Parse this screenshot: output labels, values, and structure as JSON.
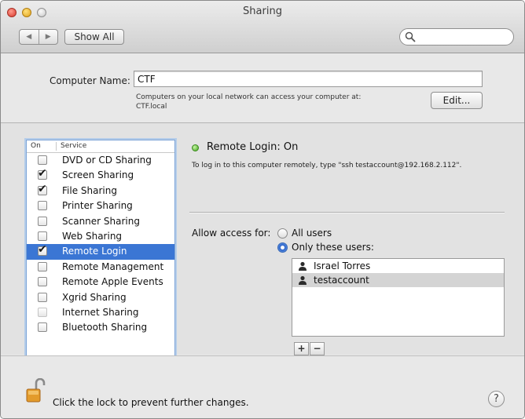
{
  "window": {
    "title": "Sharing"
  },
  "toolbar": {
    "back_glyph": "◀",
    "forward_glyph": "▶",
    "show_all_label": "Show All",
    "search": {
      "value": "",
      "placeholder": ""
    }
  },
  "computer_name": {
    "label": "Computer Name:",
    "value": "CTF",
    "description_line1": "Computers on your local network can access your computer at:",
    "description_line2": "CTF.local",
    "edit_label": "Edit..."
  },
  "services": {
    "header_on": "On",
    "header_service": "Service",
    "items": [
      {
        "label": "DVD or CD Sharing",
        "checked": false,
        "selected": false,
        "dimmed": false
      },
      {
        "label": "Screen Sharing",
        "checked": true,
        "selected": false,
        "dimmed": false
      },
      {
        "label": "File Sharing",
        "checked": true,
        "selected": false,
        "dimmed": false
      },
      {
        "label": "Printer Sharing",
        "checked": false,
        "selected": false,
        "dimmed": false
      },
      {
        "label": "Scanner Sharing",
        "checked": false,
        "selected": false,
        "dimmed": false
      },
      {
        "label": "Web Sharing",
        "checked": false,
        "selected": false,
        "dimmed": false
      },
      {
        "label": "Remote Login",
        "checked": true,
        "selected": true,
        "dimmed": false
      },
      {
        "label": "Remote Management",
        "checked": false,
        "selected": false,
        "dimmed": false
      },
      {
        "label": "Remote Apple Events",
        "checked": false,
        "selected": false,
        "dimmed": false
      },
      {
        "label": "Xgrid Sharing",
        "checked": false,
        "selected": false,
        "dimmed": false
      },
      {
        "label": "Internet Sharing",
        "checked": false,
        "selected": false,
        "dimmed": true
      },
      {
        "label": "Bluetooth Sharing",
        "checked": false,
        "selected": false,
        "dimmed": false
      }
    ]
  },
  "detail": {
    "status_title": "Remote Login: On",
    "status_color": "#3fa51a",
    "instructions": "To log in to this computer remotely, type \"ssh testaccount@192.168.2.112\".",
    "allow_access_label": "Allow access for:",
    "option_all_users": "All users",
    "option_only_these": "Only these users:",
    "selected_option": "only_these",
    "users": [
      {
        "name": "Israel Torres",
        "selected": false
      },
      {
        "name": "testaccount",
        "selected": true
      }
    ],
    "add_label": "+",
    "remove_label": "−"
  },
  "footer": {
    "lock_text": "Click the lock to prevent further changes.",
    "help_label": "?"
  },
  "colors": {
    "selection": "#3b76d4",
    "status_green": "#3fa51a"
  }
}
